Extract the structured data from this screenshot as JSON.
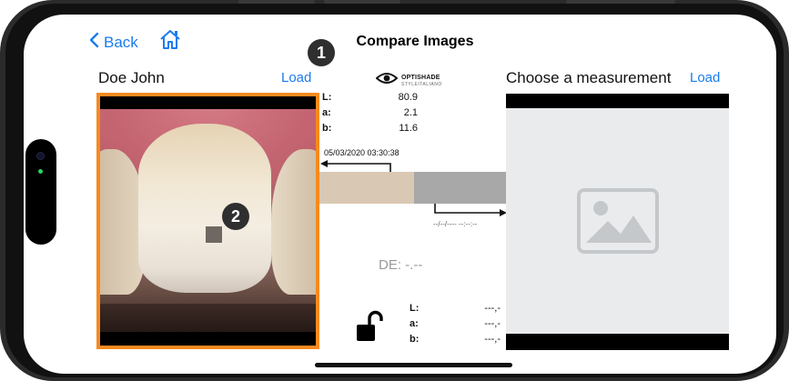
{
  "nav": {
    "back_label": "Back",
    "title": "Compare Images"
  },
  "badges": {
    "one": "1",
    "two": "2"
  },
  "left_panel": {
    "patient_name": "Doe John",
    "load_label": "Load"
  },
  "right_panel": {
    "heading": "Choose a measurement",
    "load_label": "Load"
  },
  "logo": {
    "name": "OPTISHADE",
    "tagline": "STYLEITALIANO"
  },
  "reference_measurement": {
    "labels": [
      "L:",
      "a:",
      "b:"
    ],
    "values": [
      "80.9",
      "2.1",
      "11.6"
    ],
    "timestamp": "05/03/2020 03:30:38",
    "swatch_color": "#d9c8b4"
  },
  "compared_measurement": {
    "labels": [
      "L:",
      "a:",
      "b:"
    ],
    "values": [
      "---,-",
      "---,-",
      "---,-"
    ],
    "timestamp": "--/--/---- --:--:--",
    "swatch_color": "#a8a8a8"
  },
  "delta_e": "DE: -.--",
  "colors": {
    "accent": "#1a7cf0",
    "selection_border": "#f58a1f",
    "badge": "#2f2f2f"
  },
  "icons": {
    "back": "chevron-left-icon",
    "home": "home-icon",
    "logo": "eye-icon",
    "placeholder": "image-placeholder-icon",
    "lock": "unlocked-padlock-icon"
  }
}
